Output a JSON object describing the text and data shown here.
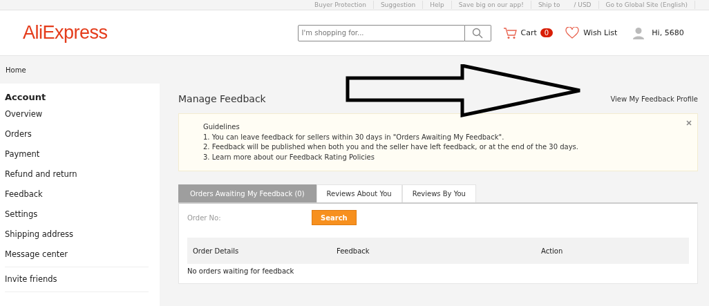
{
  "top_bar": {
    "links": [
      "Buyer Protection",
      "Suggestion",
      "Help",
      "Save big on our app!",
      "Ship to",
      "/ USD",
      "Go to Global Site (English)"
    ]
  },
  "header": {
    "logo": "AliExpress",
    "search": {
      "placeholder": "I'm shopping for..."
    },
    "cart": {
      "label": "Cart",
      "count": "0"
    },
    "wish_list": "Wish List",
    "greeting": "Hi, 5680"
  },
  "breadcrumb": "Home",
  "sidebar": {
    "title": "Account",
    "items": [
      {
        "label": "Overview"
      },
      {
        "label": "Orders"
      },
      {
        "label": "Payment"
      },
      {
        "label": "Refund and return"
      },
      {
        "label": "Feedback"
      },
      {
        "label": "Settings"
      },
      {
        "label": "Shipping address"
      },
      {
        "label": "Message center"
      }
    ],
    "extra_items": [
      {
        "label": "Invite friends"
      }
    ]
  },
  "page_title": "Manage Feedback",
  "profile_link": "View My Feedback Profile",
  "guidelines": {
    "title": "Guidelines",
    "lines": [
      "1. You can leave feedback for sellers within 30 days in \"Orders Awaiting My Feedback\".",
      "2. Feedback will be published when both you and the seller have left feedback, or at the end of the 30 days.",
      "3. Learn more about our Feedback Rating Policies"
    ]
  },
  "tabs": [
    {
      "label": "Orders Awaiting My Feedback (0)",
      "selected": true
    },
    {
      "label": "Reviews About You",
      "selected": false
    },
    {
      "label": "Reviews By You",
      "selected": false
    }
  ],
  "order_no_label": "Order No:",
  "search_button": "Search",
  "table": {
    "columns": [
      "Order Details",
      "Feedback",
      "Action"
    ],
    "empty_message": "No orders waiting for feedback"
  }
}
